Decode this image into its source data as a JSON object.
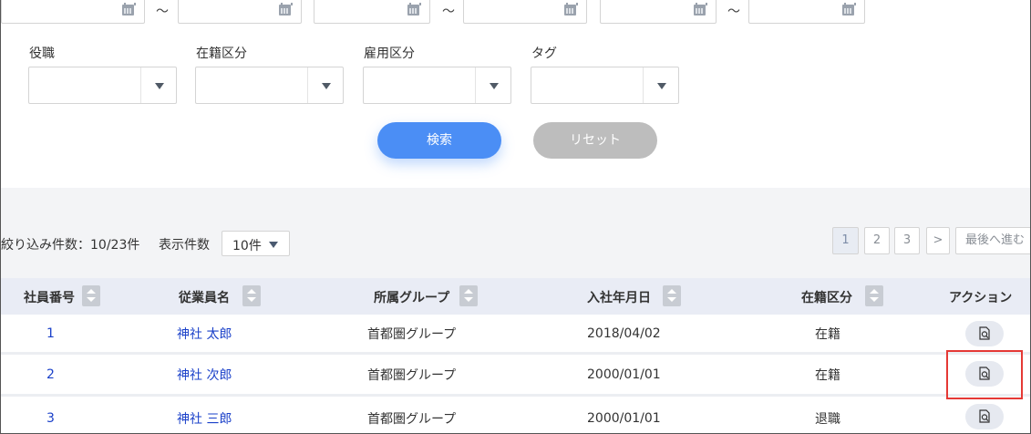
{
  "search": {
    "tilde": "～",
    "labels": {
      "position": "役職",
      "enrollment": "在籍区分",
      "employment": "雇用区分",
      "tag": "タグ"
    },
    "search_button": "検索",
    "reset_button": "リセット"
  },
  "results": {
    "count_text": "絞り込み件数：10/23件",
    "display_label": "表示件数",
    "per_page_value": "10件",
    "pages": [
      "1",
      "2",
      "3"
    ],
    "current_page": "1",
    "next": ">",
    "last": "最後へ進む"
  },
  "table": {
    "headers": {
      "id": "社員番号",
      "name": "従業員名",
      "group": "所属グループ",
      "joined": "入社年月日",
      "status": "在籍区分",
      "action": "アクション"
    },
    "rows": [
      {
        "id": "1",
        "name": "神社 太郎",
        "group": "首都圏グループ",
        "joined": "2018/04/02",
        "status": "在籍"
      },
      {
        "id": "2",
        "name": "神社 次郎",
        "group": "首都圏グループ",
        "joined": "2000/01/01",
        "status": "在籍"
      },
      {
        "id": "3",
        "name": "神社 三郎",
        "group": "首都圏グループ",
        "joined": "2000/01/01",
        "status": "退職"
      }
    ]
  },
  "colors": {
    "accent": "#4b8ef5",
    "link": "#1a40c9",
    "highlight": "#e53935"
  }
}
